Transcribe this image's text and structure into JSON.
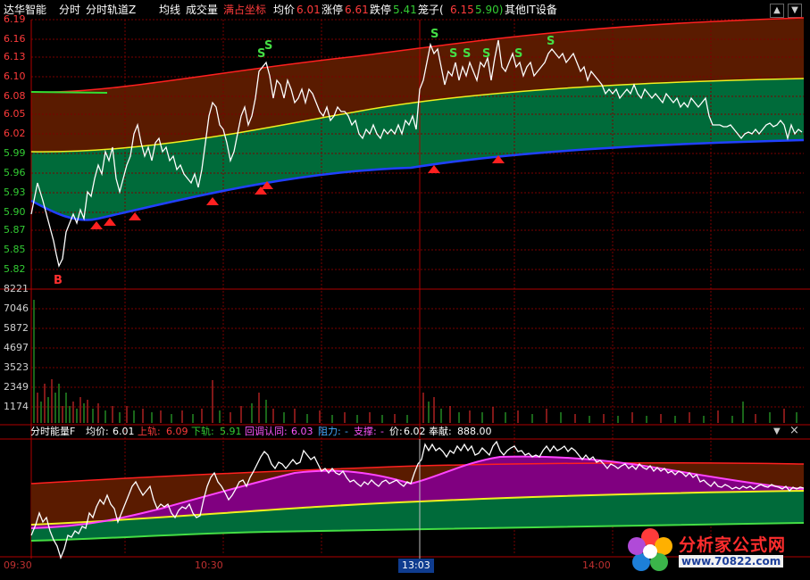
{
  "topbar": {
    "stock_name": "达华智能",
    "tab_fenshi": "分时",
    "tab_channel": "分时轨道Z",
    "tab_avg": "均线",
    "tab_volume": "成交量",
    "tab_points": "满占坐标",
    "avg_label": "均价",
    "avg_value": "6.01",
    "limit_up_label": "涨停",
    "limit_up_value": "6.61",
    "limit_down_label": "跌停",
    "limit_down_value": "5.41",
    "cage_label": "笼子(",
    "cage_high": "6.15",
    "cage_low": "5.90)",
    "sector": "其他IT设备"
  },
  "price_axis": [
    "6.19",
    "6.16",
    "6.13",
    "6.10",
    "6.08",
    "6.05",
    "6.02",
    "5.99",
    "5.96",
    "5.93",
    "5.90",
    "5.87",
    "5.85",
    "5.82"
  ],
  "volume_axis": [
    "8221",
    "7046",
    "5872",
    "4697",
    "3523",
    "2349",
    "1174"
  ],
  "signals": {
    "buy": "B",
    "sell": "S"
  },
  "sub_header": {
    "name": "分时能量F",
    "avg_label": "均价:",
    "avg_value": "6.01",
    "upper_label": "上轨:",
    "upper_value": "6.09",
    "lower_label": "下轨:",
    "lower_value": "5.91",
    "pullback_label": "回调认同:",
    "pullback_value": "6.03",
    "resist_label": "阻力:",
    "resist_value": "-",
    "support_label": "支撑:",
    "support_value": "-",
    "price_label": "价:",
    "price_value": "6.02",
    "contrib_label": "奉献:",
    "contrib_value": "888.00"
  },
  "time_axis": {
    "t1": "09:30",
    "t2": "10:30",
    "cursor": "13:03",
    "t3": "14:00"
  },
  "watermark": {
    "name": "分析家公式网",
    "url": "www.70822.com"
  },
  "colors": {
    "up": "#ff3b3b",
    "down": "#33cc33",
    "avg": "#f0f020",
    "price": "#ffffff",
    "grid": "#7a0000",
    "upper_band": "#5a1b00",
    "lower_band": "#006b3a",
    "purple": "#800080"
  }
}
